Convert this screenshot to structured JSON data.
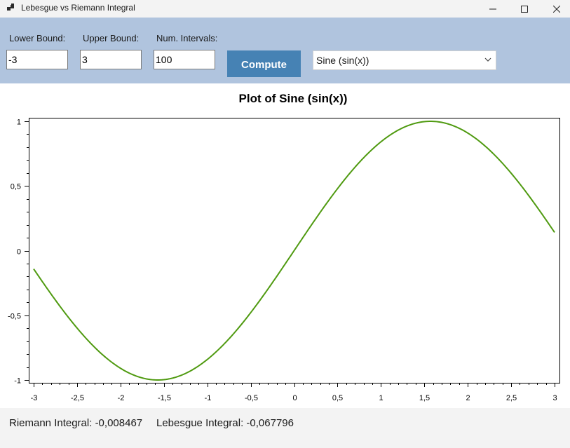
{
  "window": {
    "title": "Lebesgue vs Riemann Integral",
    "controls": [
      "minimize-icon",
      "maximize-icon",
      "close-icon"
    ]
  },
  "toolbar": {
    "lower_label": "Lower Bound:",
    "lower_value": "-3",
    "upper_label": "Upper Bound:",
    "upper_value": "3",
    "intervals_label": "Num. Intervals:",
    "intervals_value": "100",
    "compute_label": "Compute",
    "function_selected": "Sine (sin(x))",
    "colors": {
      "band": "#b0c4de",
      "button": "#4682b4"
    }
  },
  "chart_data": {
    "type": "line",
    "title": "Plot of Sine (sin(x))",
    "xlabel": "",
    "ylabel": "",
    "function": "sin(x)",
    "xlim": [
      -3,
      3
    ],
    "ylim": [
      -1,
      1
    ],
    "x_ticks": [
      "-3",
      "-2,5",
      "-2",
      "-1,5",
      "-1",
      "-0,5",
      "0",
      "0,5",
      "1",
      "1,5",
      "2",
      "2,5",
      "3"
    ],
    "x_tick_values": [
      -3,
      -2.5,
      -2,
      -1.5,
      -1,
      -0.5,
      0,
      0.5,
      1,
      1.5,
      2,
      2.5,
      3
    ],
    "y_ticks": [
      "1",
      "0,5",
      "0",
      "-0,5",
      "-1"
    ],
    "y_tick_values": [
      1,
      0.5,
      0,
      -0.5,
      -1
    ],
    "series": [
      {
        "color": "#4f9a10",
        "x": [
          -3,
          -2.75,
          -2.5,
          -2.25,
          -2,
          -1.75,
          -1.5,
          -1.25,
          -1,
          -0.75,
          -0.5,
          -0.25,
          0,
          0.25,
          0.5,
          0.75,
          1,
          1.25,
          1.5,
          1.75,
          2,
          2.25,
          2.5,
          2.75,
          3
        ],
        "y": [
          -0.1411,
          -0.3817,
          -0.5985,
          -0.7781,
          -0.9093,
          -0.984,
          -0.9975,
          -0.949,
          -0.8415,
          -0.6816,
          -0.4794,
          -0.2474,
          0,
          0.2474,
          0.4794,
          0.6816,
          0.8415,
          0.949,
          0.9975,
          0.984,
          0.9093,
          0.7781,
          0.5985,
          0.3817,
          0.1411
        ]
      }
    ],
    "grid": false,
    "legend": "none"
  },
  "status": {
    "riemann": "Riemann Integral: -0,008467",
    "lebesgue": "Lebesgue Integral: -0,067796"
  }
}
